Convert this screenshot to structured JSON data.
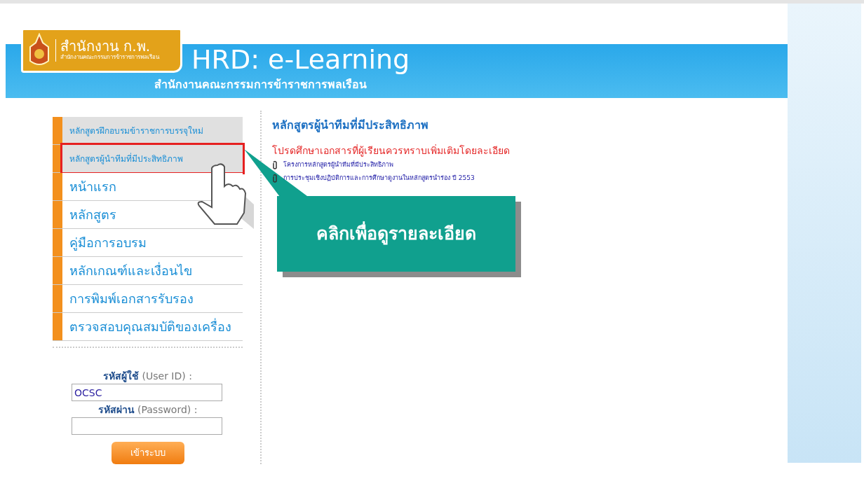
{
  "header": {
    "logo_title": "สำนักงาน ก.พ.",
    "logo_subtitle": "สำนักงานคณะกรรมการข้าราชการพลเรือน",
    "title": "HRD: e-Learning",
    "subtitle": "สำนักงานคณะกรรมการข้าราชการพลเรือน"
  },
  "sidebar": {
    "items": [
      {
        "label": "หลักสูตรฝึกอบรมข้าราชการบรรจุใหม่",
        "kind": "sub",
        "highlighted": false
      },
      {
        "label": "หลักสูตรผู้นำทีมที่มีประสิทธิภาพ",
        "kind": "sub",
        "highlighted": true
      },
      {
        "label": "หน้าแรก",
        "kind": "main",
        "highlighted": false
      },
      {
        "label": "หลักสูตร",
        "kind": "main",
        "highlighted": false
      },
      {
        "label": "คู่มือการอบรม",
        "kind": "main",
        "highlighted": false
      },
      {
        "label": "หลักเกณฑ์และเงื่อนไข",
        "kind": "main",
        "highlighted": false
      },
      {
        "label": "การพิมพ์เอกสารรับรอง",
        "kind": "main",
        "highlighted": false
      },
      {
        "label": "ตรวจสอบคุณสมบัติของเครื่อง",
        "kind": "main",
        "highlighted": false
      }
    ]
  },
  "login": {
    "user_label": "**รหัสผู้ใช้** (User ID) :",
    "user_value": "OCSC",
    "password_label": "**รหัสผ่าน** (Password) :",
    "button": "เข้าระบบ"
  },
  "content": {
    "title": "หลักสูตรผู้นำทีมที่มีประสิทธิภาพ",
    "notice": "โปรดศึกษาเอกสารที่ผู้เรียนควรทราบเพิ่มเติมโดยละเอียด",
    "documents": [
      {
        "label": "โครงการหลักสูตรผู้นำทีมที่มีประสิทธิภาพ"
      },
      {
        "label": "การประชุมเชิงปฏิบัติการและการศึกษาดูงานในหลักสูตรนำร่อง ปี 2553"
      }
    ]
  },
  "callout": {
    "text": "คลิกเพื่อดูรายละเอียด"
  }
}
